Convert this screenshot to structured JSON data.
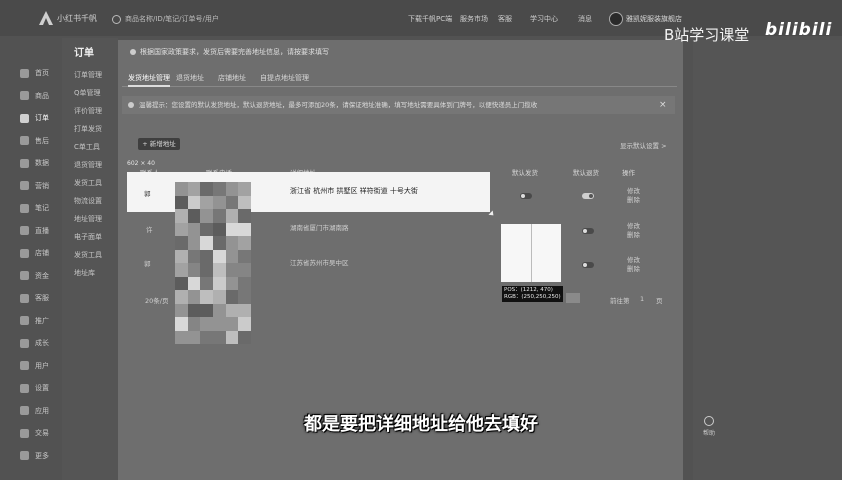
{
  "app": {
    "brand": "小红书千帆"
  },
  "search": {
    "placeholder": "商品名称/ID/笔记/订单号/用户"
  },
  "topnav": [
    {
      "label": "下载千帆PC端"
    },
    {
      "label": "服务市场"
    },
    {
      "label": "客服"
    },
    {
      "label": "学习中心"
    },
    {
      "label": "消息"
    }
  ],
  "shop": {
    "name": "雅凯妮服装旗舰店"
  },
  "watermark": {
    "text": "B站学习课堂",
    "logo": "bilibili"
  },
  "leftnav": [
    {
      "label": "首页"
    },
    {
      "label": "商品"
    },
    {
      "label": "订单",
      "active": true
    },
    {
      "label": "售后"
    },
    {
      "label": "数据"
    },
    {
      "label": "营销"
    },
    {
      "label": "笔记"
    },
    {
      "label": "直播"
    },
    {
      "label": "店铺"
    },
    {
      "label": "资金"
    },
    {
      "label": "客服"
    },
    {
      "label": "推广"
    },
    {
      "label": "成长"
    },
    {
      "label": "用户"
    },
    {
      "label": "设置"
    },
    {
      "label": "应用"
    },
    {
      "label": "交易"
    },
    {
      "label": "更多"
    }
  ],
  "subnav": {
    "title": "订单",
    "items": [
      "订单管理",
      "Q单管理",
      "评价管理",
      "打单发货",
      "C单工具",
      "退货管理",
      "发货工具",
      "物流设置",
      "地址管理",
      "电子面单",
      "发货工具",
      "地址库"
    ]
  },
  "dialog": {
    "notice": "根据国家政策要求，发货后需要完善地址信息，请按要求填写",
    "tabs": [
      "发货地址管理",
      "退货地址",
      "店铺地址",
      "自提点地址管理"
    ],
    "info": "温馨提示：您设置的默认发货地址，默认退货地址，最多可添加20条，请保证地址准确，填写地址需要具体到门牌号，以便快递员上门揽收",
    "add_button": "+ 新增地址",
    "settings_link": "显示默认设置 >",
    "row_selector": "602 × 40",
    "columns": [
      "联系人",
      "联系电话",
      "详细地址",
      "默认发货",
      "默认退货",
      "操作"
    ],
    "rows": [
      {
        "name": "郭",
        "address": "浙江省 杭州市 拱墅区 祥符街道 十号大街",
        "ops": [
          "修改",
          "删除"
        ]
      },
      {
        "name": "许",
        "address": "湖南省厦门市湖南路",
        "ops": [
          "修改",
          "删除"
        ]
      },
      {
        "name": "郭",
        "address": "江苏省苏州市吴中区",
        "ops": [
          "修改",
          "删除"
        ]
      }
    ],
    "pagination": {
      "total": "20条/页",
      "goto": "前往第",
      "page": "1",
      "unit": "页"
    }
  },
  "color_tip": {
    "pos": "POS：(1212, 470)",
    "rgb": "RGB：(250,250,250)"
  },
  "help": {
    "label": "帮助"
  },
  "subtitle": "都是要把详细地址给他去填好",
  "colors": {
    "highlight_row": "#f4f4f4",
    "dim": "#525252"
  }
}
